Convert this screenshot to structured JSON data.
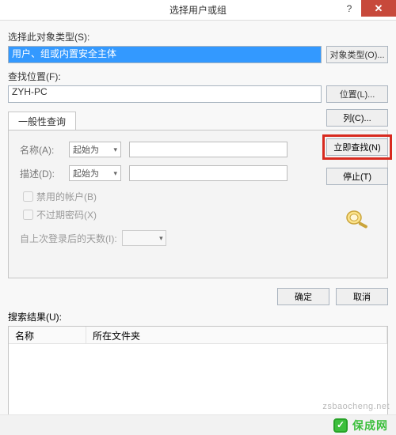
{
  "dialog": {
    "title": "选择用户或组"
  },
  "sections": {
    "object_type_label": "选择此对象类型(S):",
    "object_type_value": "用户、组或内置安全主体",
    "object_type_btn": "对象类型(O)...",
    "location_label": "查找位置(F):",
    "location_value": "ZYH-PC",
    "location_btn": "位置(L)..."
  },
  "tab": {
    "label": "一般性查询"
  },
  "form": {
    "name_label": "名称(A):",
    "desc_label": "描述(D):",
    "starts_with": "起始为",
    "disabled_acc": "禁用的帐户(B)",
    "pwd_noexpire": "不过期密码(X)",
    "last_login": "自上次登录后的天数(I):"
  },
  "right_buttons": {
    "columns": "列(C)...",
    "find_now": "立即查找(N)",
    "stop": "停止(T)"
  },
  "dlg_buttons": {
    "ok": "确定",
    "cancel": "取消"
  },
  "results": {
    "label": "搜索结果(U):",
    "col_name": "名称",
    "col_folder": "所在文件夹"
  },
  "watermark": "zsbaocheng.net",
  "brand": "保成网"
}
